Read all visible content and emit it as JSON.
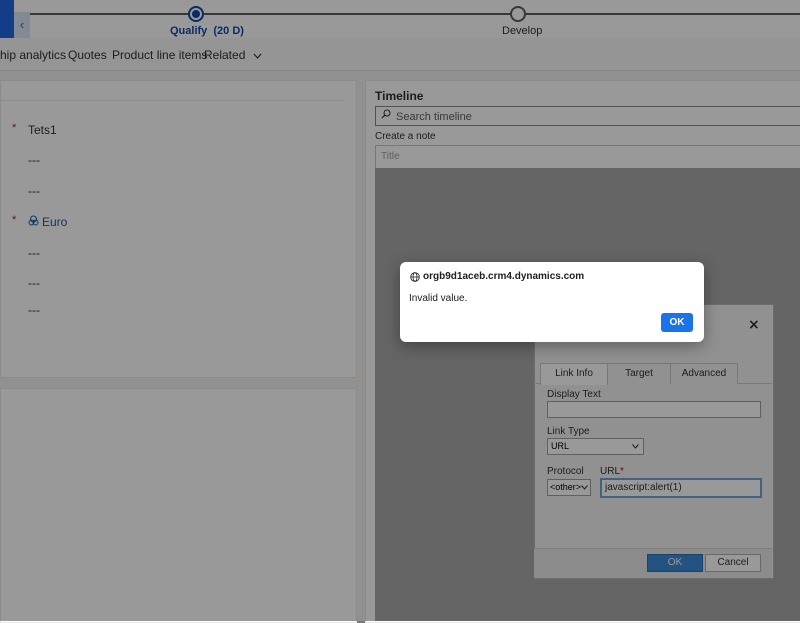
{
  "stage_bar": {
    "back_icon": "chevron-left-icon",
    "active_stage": "Qualify  (20 D)",
    "next_stage": "Develop"
  },
  "tabs": [
    "hip analytics",
    "Quotes",
    "Product line items",
    "Related"
  ],
  "related_icon": "chevron-down-icon",
  "form": {
    "fields": [
      {
        "required": true,
        "value": "Tets1"
      },
      {
        "required": false,
        "value": "---"
      },
      {
        "required": false,
        "value": "---"
      },
      {
        "required": true,
        "value": "Euro",
        "icon": "currency-icon"
      },
      {
        "required": false,
        "value": "---"
      },
      {
        "required": false,
        "value": "---"
      },
      {
        "required": false,
        "value": "---"
      }
    ],
    "required_mark": "*"
  },
  "timeline": {
    "title": "Timeline",
    "search_placeholder": "Search timeline",
    "create_note_label": "Create a note",
    "note_title_placeholder": "Title"
  },
  "link_dialog": {
    "tabs": [
      "Link Info",
      "Target",
      "Advanced"
    ],
    "display_text_label": "Display Text",
    "display_text_value": "",
    "link_type_label": "Link Type",
    "link_type_value": "URL",
    "protocol_label": "Protocol",
    "protocol_value": "<other>",
    "url_label": "URL",
    "url_required_mark": "*",
    "url_value": "javascript:alert(1)",
    "ok_label": "OK",
    "cancel_label": "Cancel",
    "close_symbol": "×"
  },
  "alert": {
    "origin": "orgb9d1aceb.crm4.dynamics.com",
    "message": "Invalid value.",
    "ok_label": "OK",
    "globe_icon": "globe-icon"
  }
}
